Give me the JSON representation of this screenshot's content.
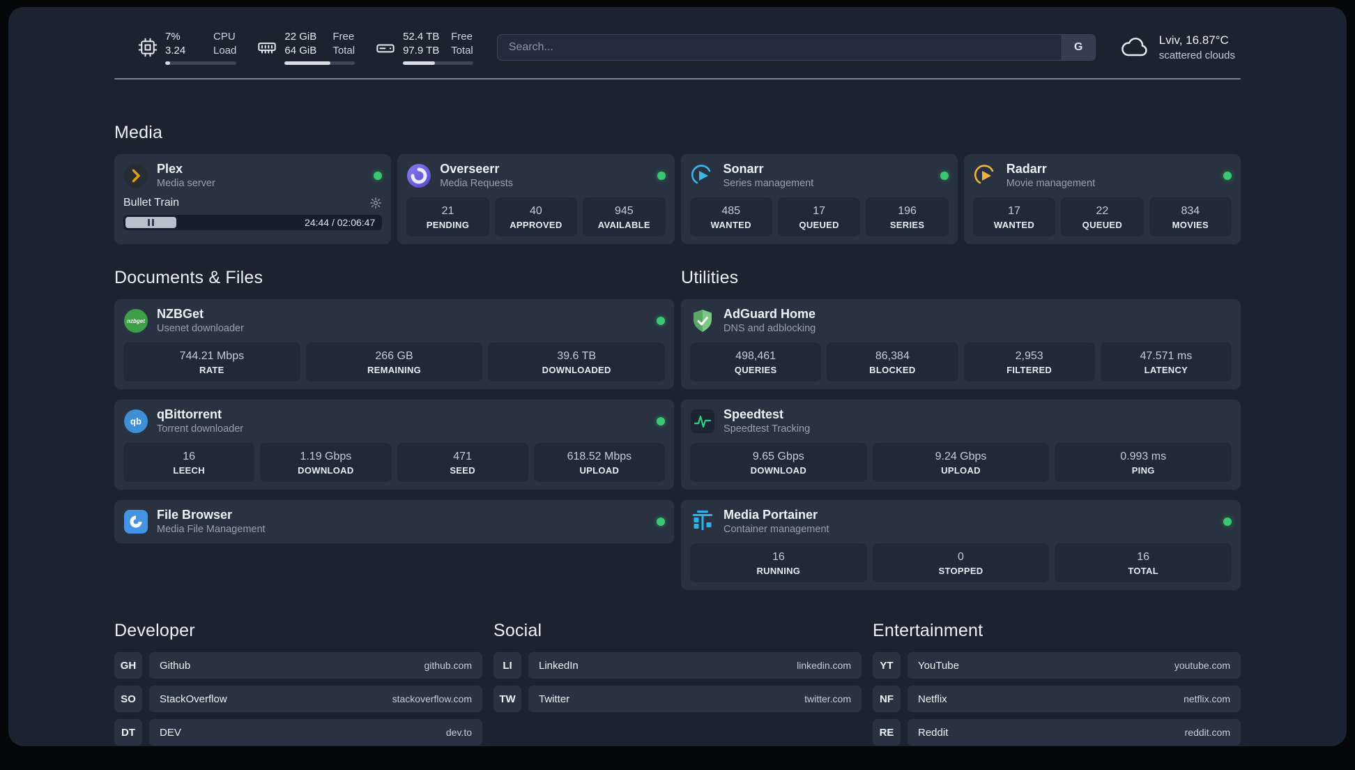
{
  "colors": {
    "status_online": "#38c96e",
    "background": "#1b2331",
    "card": "#293241",
    "stat_box": "#202938",
    "plex_accent": "#e5a00d"
  },
  "header": {
    "cpu": {
      "value_top": "7%",
      "value_bottom": "3.24",
      "label_top": "CPU",
      "label_bottom": "Load",
      "bar_percent": 7
    },
    "memory": {
      "value_top": "22 GiB",
      "value_bottom": "64 GiB",
      "label_top": "Free",
      "label_bottom": "Total",
      "bar_percent": 65
    },
    "storage": {
      "value_top": "52.4 TB",
      "value_bottom": "97.9 TB",
      "label_top": "Free",
      "label_bottom": "Total",
      "bar_percent": 46
    },
    "search": {
      "placeholder": "Search...",
      "button_label": "G"
    },
    "weather": {
      "location": "Lviv, 16.87°C",
      "condition": "scattered clouds"
    }
  },
  "media": {
    "title": "Media",
    "apps": [
      {
        "name": "Plex",
        "subtitle": "Media server",
        "online": true,
        "now_playing": {
          "title": "Bullet Train",
          "time": "24:44 / 02:06:47",
          "progress_percent": 19.6
        }
      },
      {
        "name": "Overseerr",
        "subtitle": "Media Requests",
        "online": true,
        "stats": [
          {
            "value": "21",
            "label": "PENDING"
          },
          {
            "value": "40",
            "label": "APPROVED"
          },
          {
            "value": "945",
            "label": "AVAILABLE"
          }
        ]
      },
      {
        "name": "Sonarr",
        "subtitle": "Series management",
        "online": true,
        "stats": [
          {
            "value": "485",
            "label": "WANTED"
          },
          {
            "value": "17",
            "label": "QUEUED"
          },
          {
            "value": "196",
            "label": "SERIES"
          }
        ]
      },
      {
        "name": "Radarr",
        "subtitle": "Movie management",
        "online": true,
        "stats": [
          {
            "value": "17",
            "label": "WANTED"
          },
          {
            "value": "22",
            "label": "QUEUED"
          },
          {
            "value": "834",
            "label": "MOVIES"
          }
        ]
      }
    ]
  },
  "documents": {
    "title": "Documents & Files",
    "apps": [
      {
        "name": "NZBGet",
        "subtitle": "Usenet downloader",
        "online": true,
        "stats": [
          {
            "value": "744.21 Mbps",
            "label": "RATE"
          },
          {
            "value": "266 GB",
            "label": "REMAINING"
          },
          {
            "value": "39.6 TB",
            "label": "DOWNLOADED"
          }
        ]
      },
      {
        "name": "qBittorrent",
        "subtitle": "Torrent downloader",
        "online": true,
        "stats": [
          {
            "value": "16",
            "label": "LEECH"
          },
          {
            "value": "1.19 Gbps",
            "label": "DOWNLOAD"
          },
          {
            "value": "471",
            "label": "SEED"
          },
          {
            "value": "618.52 Mbps",
            "label": "UPLOAD"
          }
        ]
      },
      {
        "name": "File Browser",
        "subtitle": "Media File Management",
        "online": true
      }
    ]
  },
  "utilities": {
    "title": "Utilities",
    "apps": [
      {
        "name": "AdGuard Home",
        "subtitle": "DNS and adblocking",
        "stats": [
          {
            "value": "498,461",
            "label": "QUERIES"
          },
          {
            "value": "86,384",
            "label": "BLOCKED"
          },
          {
            "value": "2,953",
            "label": "FILTERED"
          },
          {
            "value": "47.571 ms",
            "label": "LATENCY"
          }
        ]
      },
      {
        "name": "Speedtest",
        "subtitle": "Speedtest Tracking",
        "stats": [
          {
            "value": "9.65 Gbps",
            "label": "DOWNLOAD"
          },
          {
            "value": "9.24 Gbps",
            "label": "UPLOAD"
          },
          {
            "value": "0.993 ms",
            "label": "PING"
          }
        ]
      },
      {
        "name": "Media Portainer",
        "subtitle": "Container management",
        "online": true,
        "stats": [
          {
            "value": "16",
            "label": "RUNNING"
          },
          {
            "value": "0",
            "label": "STOPPED"
          },
          {
            "value": "16",
            "label": "TOTAL"
          }
        ]
      }
    ]
  },
  "link_groups": [
    {
      "title": "Developer",
      "items": [
        {
          "abbr": "GH",
          "name": "Github",
          "url": "github.com"
        },
        {
          "abbr": "SO",
          "name": "StackOverflow",
          "url": "stackoverflow.com"
        },
        {
          "abbr": "DT",
          "name": "DEV",
          "url": "dev.to"
        }
      ]
    },
    {
      "title": "Social",
      "items": [
        {
          "abbr": "LI",
          "name": "LinkedIn",
          "url": "linkedin.com"
        },
        {
          "abbr": "TW",
          "name": "Twitter",
          "url": "twitter.com"
        }
      ]
    },
    {
      "title": "Entertainment",
      "items": [
        {
          "abbr": "YT",
          "name": "YouTube",
          "url": "youtube.com"
        },
        {
          "abbr": "NF",
          "name": "Netflix",
          "url": "netflix.com"
        },
        {
          "abbr": "RE",
          "name": "Reddit",
          "url": "reddit.com"
        }
      ]
    }
  ]
}
